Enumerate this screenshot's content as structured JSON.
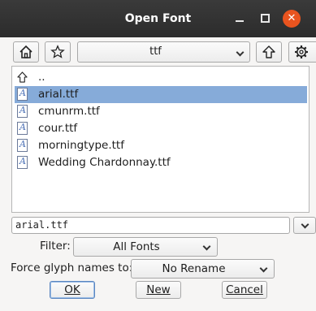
{
  "window": {
    "title": "Open Font"
  },
  "toolbar": {
    "directory": "ttf"
  },
  "files": [
    {
      "name": "..",
      "type": "parent"
    },
    {
      "name": "arial.ttf",
      "type": "font",
      "selected": true
    },
    {
      "name": "cmunrm.ttf",
      "type": "font"
    },
    {
      "name": "cour.ttf",
      "type": "font"
    },
    {
      "name": "morningtype.ttf",
      "type": "font"
    },
    {
      "name": "Wedding Chardonnay.ttf",
      "type": "font"
    }
  ],
  "filename": {
    "value": "arial.ttf"
  },
  "filter": {
    "label": "Filter:",
    "value": "All Fonts"
  },
  "glyph_names": {
    "label": "Force glyph names to:",
    "value": "No Rename"
  },
  "buttons": {
    "ok": "OK",
    "new": "New",
    "cancel": "Cancel"
  },
  "colors": {
    "selection": "#86abd9",
    "close_button": "#e9541f",
    "titlebar": "#2f2f2f"
  }
}
